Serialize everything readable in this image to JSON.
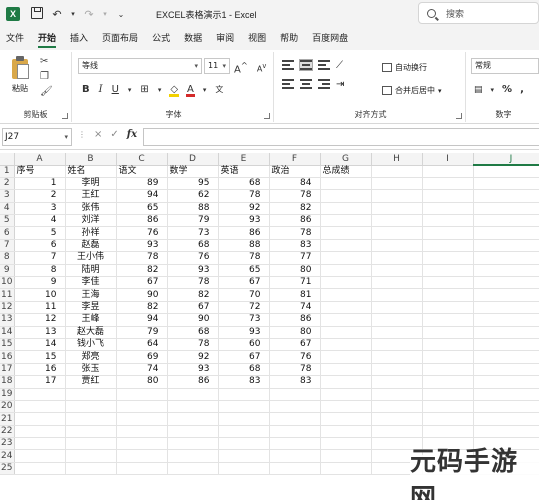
{
  "window": {
    "title": "EXCEL表格演示1  -  Excel",
    "search_placeholder": "搜索",
    "app_icon_letter": "X"
  },
  "menu": {
    "tabs": [
      "文件",
      "开始",
      "插入",
      "页面布局",
      "公式",
      "数据",
      "审阅",
      "视图",
      "帮助",
      "百度网盘"
    ],
    "active_tab": "开始"
  },
  "ribbon": {
    "clipboard": {
      "paste_label": "粘贴",
      "group_label": "剪贴板"
    },
    "font": {
      "font_name": "等线",
      "font_size": "11",
      "bold": "B",
      "italic": "I",
      "underline": "U",
      "group_label": "字体"
    },
    "alignment": {
      "wrap_text": "自动换行",
      "merge_center": "合并后居中",
      "group_label": "对齐方式"
    },
    "number": {
      "format": "常规",
      "percent": "%",
      "group_label": "数字"
    }
  },
  "formula_bar": {
    "name_box": "J27",
    "fx_label": "fx",
    "cancel": "×",
    "enter": "✓",
    "value": ""
  },
  "sheet": {
    "columns": [
      "A",
      "B",
      "C",
      "D",
      "E",
      "F",
      "G",
      "H",
      "I",
      "J"
    ],
    "selected_column": "J",
    "row_numbers": [
      "1",
      "2",
      "3",
      "4",
      "5",
      "6",
      "7",
      "8",
      "9",
      "10",
      "11",
      "12",
      "13",
      "14",
      "15",
      "16",
      "17",
      "18",
      "19",
      "20",
      "21",
      "22",
      "23",
      "24",
      "25"
    ],
    "headers": [
      "序号",
      "姓名",
      "语文",
      "数学",
      "英语",
      "政治",
      "总成绩"
    ],
    "rows": [
      [
        "1",
        "李明",
        "89",
        "95",
        "68",
        "84"
      ],
      [
        "2",
        "王红",
        "94",
        "62",
        "78",
        "78"
      ],
      [
        "3",
        "张伟",
        "65",
        "88",
        "92",
        "82"
      ],
      [
        "4",
        "刘洋",
        "86",
        "79",
        "93",
        "86"
      ],
      [
        "5",
        "孙祥",
        "76",
        "73",
        "86",
        "78"
      ],
      [
        "6",
        "赵磊",
        "93",
        "68",
        "88",
        "83"
      ],
      [
        "7",
        "王小伟",
        "78",
        "76",
        "78",
        "77"
      ],
      [
        "8",
        "陆明",
        "82",
        "93",
        "65",
        "80"
      ],
      [
        "9",
        "李佳",
        "67",
        "78",
        "67",
        "71"
      ],
      [
        "10",
        "王海",
        "90",
        "82",
        "70",
        "81"
      ],
      [
        "11",
        "李昱",
        "82",
        "67",
        "72",
        "74"
      ],
      [
        "12",
        "王峰",
        "94",
        "90",
        "73",
        "86"
      ],
      [
        "13",
        "赵大磊",
        "79",
        "68",
        "93",
        "80"
      ],
      [
        "14",
        "钱小飞",
        "64",
        "78",
        "60",
        "67"
      ],
      [
        "15",
        "郑亮",
        "69",
        "92",
        "67",
        "76"
      ],
      [
        "16",
        "张玉",
        "74",
        "93",
        "68",
        "78"
      ],
      [
        "17",
        "贾红",
        "80",
        "86",
        "83",
        "83"
      ]
    ]
  },
  "watermark": "元码手游网",
  "colors": {
    "excel_green": "#1f7a45",
    "font_color_red": "#d42a2a",
    "fill_yellow": "#f2d100"
  }
}
